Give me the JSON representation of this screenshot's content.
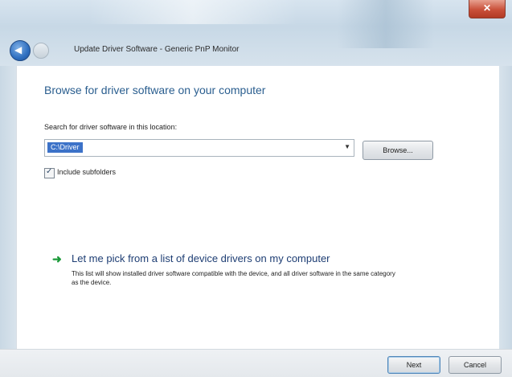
{
  "window": {
    "title": "Update Driver Software - Generic PnP Monitor"
  },
  "page": {
    "heading": "Browse for driver software on your computer",
    "search_label": "Search for driver software in this location:",
    "location_value": "C:\\Driver",
    "browse_label": "Browse...",
    "include_subfolders_label": "Include subfolders",
    "include_subfolders_checked": true,
    "pick_title": "Let me pick from a list of device drivers on my computer",
    "pick_description": "This list will show installed driver software compatible with the device, and all driver software in the same category as the device."
  },
  "footer": {
    "next_label": "Next",
    "cancel_label": "Cancel"
  },
  "icons": {
    "back": "back-arrow-icon",
    "forward": "forward-icon",
    "close": "close-icon",
    "pick": "green-arrow-icon",
    "dropdown": "chevron-down-icon"
  },
  "colors": {
    "heading": "#2a5e8f",
    "link": "#1d3d73",
    "selection": "#3c72c8",
    "close": "#c9503a"
  }
}
